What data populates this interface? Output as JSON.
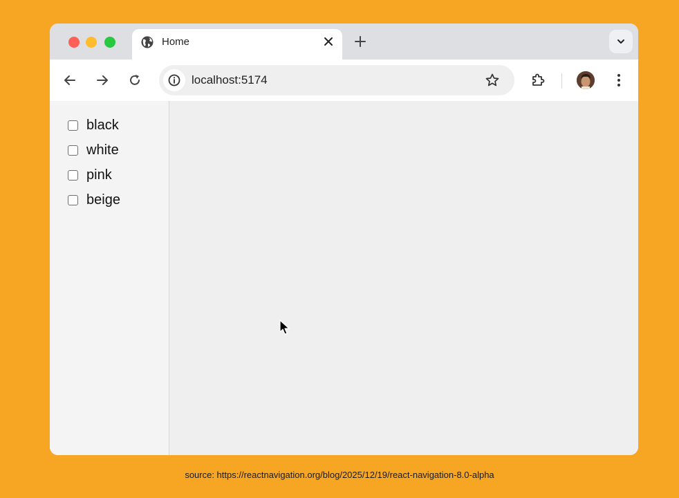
{
  "browser": {
    "tab": {
      "title": "Home",
      "icon": "globe-icon"
    },
    "address_bar": {
      "url": "localhost:5174"
    }
  },
  "sidebar": {
    "checkboxes": [
      {
        "label": "black",
        "checked": false
      },
      {
        "label": "white",
        "checked": false
      },
      {
        "label": "pink",
        "checked": false
      },
      {
        "label": "beige",
        "checked": false
      }
    ]
  },
  "caption": {
    "text": "source: https://reactnavigation.org/blog/2025/12/19/react-navigation-8.0-alpha"
  },
  "colors": {
    "background": "#f6a623",
    "tabstrip": "#dedfe3",
    "close_dot": "#fe5f57",
    "minimize_dot": "#febc2e",
    "zoom_dot": "#28c840"
  }
}
